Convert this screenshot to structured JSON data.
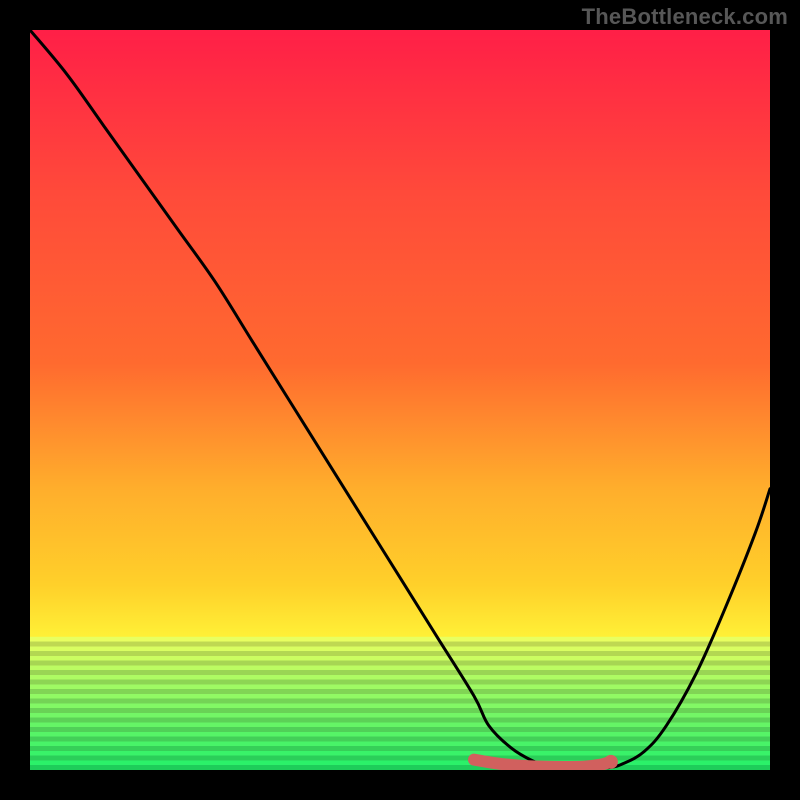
{
  "watermark": "TheBottleneck.com",
  "colors": {
    "bg": "#000000",
    "watermark": "#575757",
    "curve": "#000000",
    "highlight": "#d1605e",
    "grad_top": "#ff1f47",
    "grad_mid1": "#ff6a2f",
    "grad_mid2": "#ffd02a",
    "grad_mid3": "#fff93a",
    "grad_mid4": "#e4ff5a",
    "grad_bottom": "#1cf06a"
  },
  "chart_data": {
    "type": "line",
    "title": "",
    "xlabel": "",
    "ylabel": "",
    "xlim": [
      0,
      100
    ],
    "ylim": [
      0,
      100
    ],
    "series": [
      {
        "name": "bottleneck-curve",
        "x": [
          0,
          5,
          10,
          15,
          20,
          25,
          30,
          35,
          40,
          45,
          50,
          55,
          60,
          62,
          65,
          68,
          70,
          72,
          75,
          78,
          80,
          83,
          86,
          90,
          94,
          98,
          100
        ],
        "y": [
          100,
          94,
          87,
          80,
          73,
          66,
          58,
          50,
          42,
          34,
          26,
          18,
          10,
          6,
          3,
          1.2,
          0.6,
          0.3,
          0.2,
          0.3,
          0.8,
          2.5,
          6,
          13,
          22,
          32,
          38
        ]
      }
    ],
    "highlight_segment": {
      "x": [
        60,
        63,
        66,
        69,
        72,
        75,
        77,
        78.5
      ],
      "y": [
        1.4,
        0.9,
        0.6,
        0.45,
        0.4,
        0.45,
        0.7,
        1.1
      ]
    },
    "highlight_point": {
      "x": 78.5,
      "y": 1.1
    },
    "gradient_stops_pct": [
      0,
      22,
      55,
      78,
      88,
      94,
      97,
      100
    ],
    "striation_band": {
      "y_from": 82,
      "y_to": 100
    }
  }
}
